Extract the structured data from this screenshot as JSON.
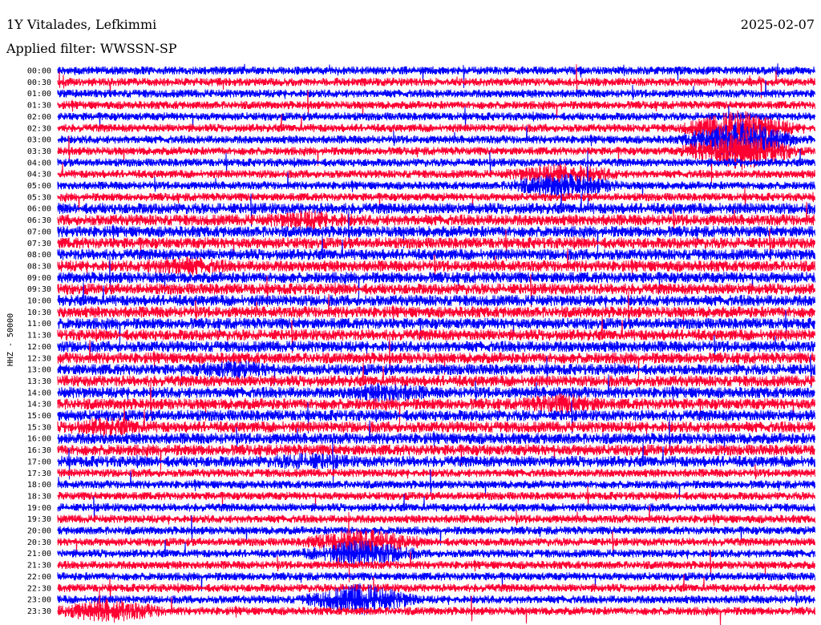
{
  "chart_data": {
    "type": "line",
    "title": "1Y Vitalades, Lefkimmi",
    "date": "2025-02-07",
    "subtitle": "Applied filter: WWSSN-SP",
    "ylabel": "HHZ - 50000",
    "time_labels": [
      "00:00",
      "00:30",
      "01:00",
      "01:30",
      "02:00",
      "02:30",
      "03:00",
      "03:30",
      "04:00",
      "04:30",
      "05:00",
      "05:30",
      "06:00",
      "06:30",
      "07:00",
      "07:30",
      "08:00",
      "08:30",
      "09:00",
      "09:30",
      "10:00",
      "10:30",
      "11:00",
      "11:30",
      "12:00",
      "12:30",
      "13:00",
      "13:30",
      "14:00",
      "14:30",
      "15:00",
      "15:30",
      "16:00",
      "16:30",
      "17:00",
      "17:30",
      "18:00",
      "18:30",
      "19:00",
      "19:30",
      "20:00",
      "20:30",
      "21:00",
      "21:30",
      "22:00",
      "22:30",
      "23:00",
      "23:30"
    ],
    "trace_colors": [
      "#0000ff",
      "#ff0033"
    ],
    "grid": false,
    "legend": "none",
    "noise_bursts": [
      {
        "time": "05:00",
        "minute": 20,
        "amplitude": 2.2
      },
      {
        "time": "04:30",
        "minute": 20,
        "amplitude": 1.8
      },
      {
        "time": "03:00",
        "minute": 27,
        "amplitude": 4.0
      },
      {
        "time": "03:30",
        "minute": 27,
        "amplitude": 4.0
      },
      {
        "time": "02:30",
        "minute": 27,
        "amplitude": 3.5
      },
      {
        "time": "06:30",
        "minute": 10,
        "amplitude": 1.6
      },
      {
        "time": "08:30",
        "minute": 5,
        "amplitude": 1.5
      },
      {
        "time": "13:00",
        "minute": 7,
        "amplitude": 1.4
      },
      {
        "time": "14:00",
        "minute": 13,
        "amplitude": 1.5
      },
      {
        "time": "14:30",
        "minute": 20,
        "amplitude": 1.6
      },
      {
        "time": "15:30",
        "minute": 2,
        "amplitude": 1.4
      },
      {
        "time": "17:00",
        "minute": 10,
        "amplitude": 1.3
      },
      {
        "time": "20:30",
        "minute": 12,
        "amplitude": 2.5
      },
      {
        "time": "21:00",
        "minute": 12,
        "amplitude": 2.5
      },
      {
        "time": "23:00",
        "minute": 12,
        "amplitude": 3.0
      },
      {
        "time": "23:30",
        "minute": 2,
        "amplitude": 2.0
      }
    ]
  }
}
